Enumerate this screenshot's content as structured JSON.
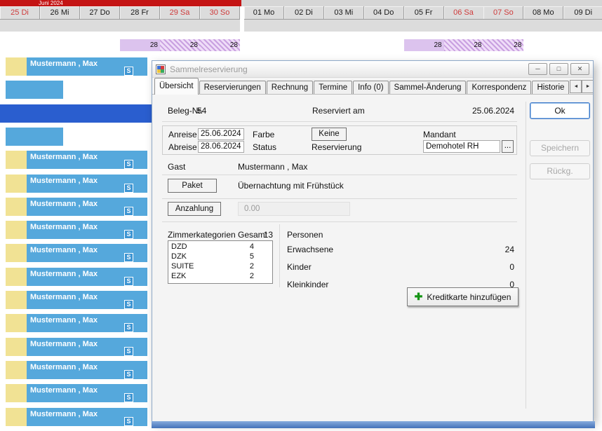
{
  "calendar": {
    "month_label": "Juni 2024",
    "days": [
      {
        "label": "25 Di",
        "red": true
      },
      {
        "label": "26 Mi",
        "red": false
      },
      {
        "label": "27 Do",
        "red": false
      },
      {
        "label": "28 Fr",
        "red": false
      },
      {
        "label": "29 Sa",
        "red": true
      },
      {
        "label": "30 So",
        "red": true
      },
      {
        "label": "01 Mo",
        "red": false
      },
      {
        "label": "02 Di",
        "red": false
      },
      {
        "label": "03 Mi",
        "red": false
      },
      {
        "label": "04 Do",
        "red": false
      },
      {
        "label": "05 Fr",
        "red": false
      },
      {
        "label": "06 Sa",
        "red": true
      },
      {
        "label": "07 So",
        "red": true
      },
      {
        "label": "08 Mo",
        "red": false
      },
      {
        "label": "09 Di",
        "red": false
      }
    ],
    "availability": [
      {
        "col": 3,
        "value": "28",
        "hatched": false
      },
      {
        "col": 4,
        "value": "28",
        "hatched": true
      },
      {
        "col": 5,
        "value": "28",
        "hatched": true
      },
      {
        "col": 10,
        "value": "28",
        "hatched": false
      },
      {
        "col": 11,
        "value": "28",
        "hatched": true
      },
      {
        "col": 12,
        "value": "28",
        "hatched": true
      }
    ]
  },
  "timeline": {
    "guest_name": "Mustermann , Max",
    "badge": "S",
    "rows": [
      "full",
      "short",
      "selected",
      "short",
      "full",
      "full",
      "full",
      "full",
      "full",
      "full",
      "full",
      "full",
      "full",
      "full",
      "full",
      "full"
    ]
  },
  "dialog": {
    "title": "Sammelreservierung",
    "window_icons": {
      "minimize": "─",
      "maximize": "□",
      "close": "✕",
      "arrow_left": "◄",
      "arrow_right": "►",
      "plus": "✚"
    },
    "tabs": [
      {
        "label": "Übersicht",
        "active": true
      },
      {
        "label": "Reservierungen",
        "active": false
      },
      {
        "label": "Rechnung",
        "active": false
      },
      {
        "label": "Termine",
        "active": false
      },
      {
        "label": "Info (0)",
        "active": false
      },
      {
        "label": "Sammel-Änderung",
        "active": false
      },
      {
        "label": "Korrespondenz",
        "active": false
      },
      {
        "label": "Historie",
        "active": false
      }
    ],
    "overview": {
      "beleg_label": "Beleg-Nr.",
      "beleg_value": "54",
      "reserviert_label": "Reserviert am",
      "reserviert_value": "25.06.2024",
      "anreise_label": "Anreise",
      "anreise_value": "25.06.2024",
      "abreise_label": "Abreise",
      "abreise_value": "28.06.2024",
      "farbe_label": "Farbe",
      "farbe_button": "Keine",
      "status_label": "Status",
      "status_value": "Reservierung",
      "mandant_label": "Mandant",
      "mandant_value": "Demohotel RH",
      "mandant_browse": "...",
      "gast_label": "Gast",
      "gast_value": "Mustermann , Max",
      "paket_button": "Paket",
      "paket_value": "Übernachtung mit Frühstück",
      "anzahlung_button": "Anzahlung",
      "anzahlung_value": "0.00",
      "kategorien_label": "Zimmerkategorien",
      "gesamt_label": "Gesamt",
      "gesamt_value": "13",
      "kategorien": [
        {
          "name": "DZD",
          "count": "4"
        },
        {
          "name": "DZK",
          "count": "5"
        },
        {
          "name": "SUITE",
          "count": "2"
        },
        {
          "name": "EZK",
          "count": "2"
        }
      ],
      "personen_label": "Personen",
      "personen": [
        {
          "name": "Erwachsene",
          "count": "24"
        },
        {
          "name": "Kinder",
          "count": "0"
        },
        {
          "name": "Kleinkinder",
          "count": "0"
        }
      ],
      "kreditkarte_button": "Kreditkarte hinzufügen"
    },
    "actions": {
      "ok": "Ok",
      "speichern": "Speichern",
      "rueckg": "Rückg."
    }
  },
  "colors": {
    "month_bar": "#c41414",
    "weekend_text": "#cf3b3b",
    "reservation_bar": "#55a8dc",
    "selected_row": "#2a5ecf",
    "room_strip": "#f1e294",
    "availability_cell": "#dcc3ee",
    "focus_border": "#3a76c8",
    "plus_green": "#159415"
  }
}
